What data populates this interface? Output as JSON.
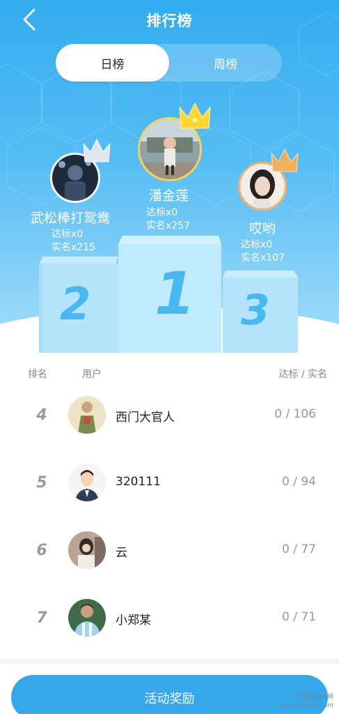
{
  "header": {
    "title": "排行榜",
    "back_icon": "chevron-left-icon"
  },
  "tabs": [
    {
      "label": "日榜",
      "active": true
    },
    {
      "label": "周榜",
      "active": false
    }
  ],
  "podium": [
    {
      "place": "1",
      "name": "潘金莲",
      "stat1": "达标x0",
      "stat2": "实名x257",
      "crown_color": "#ffd633"
    },
    {
      "place": "2",
      "name": "武松棒打鸳鸯",
      "stat1": "达标x0",
      "stat2": "实名x215",
      "crown_color": "#dfe6ee"
    },
    {
      "place": "3",
      "name": "哎哟",
      "stat1": "达标x0",
      "stat2": "实名x107",
      "crown_color": "#f0b060"
    }
  ],
  "list": {
    "header": {
      "rank": "排名",
      "user": "用户",
      "score": "达标 / 实名"
    },
    "rows": [
      {
        "rank": "4",
        "name": "西门大官人",
        "score": "0 / 106"
      },
      {
        "rank": "5",
        "name": "320111",
        "score": "0 / 94"
      },
      {
        "rank": "6",
        "name": "云",
        "score": "0 / 77"
      },
      {
        "rank": "7",
        "name": "小郑某",
        "score": "0 / 71"
      }
    ]
  },
  "footer": {
    "button_label": "活动奖励"
  },
  "watermark": {
    "line1": "Mi信息资源网",
    "line2": "www.mixinxi.com"
  },
  "colors": {
    "accent": "#35a7ea",
    "hero_top": "#33acef",
    "podium_number": "#48b8f0"
  }
}
